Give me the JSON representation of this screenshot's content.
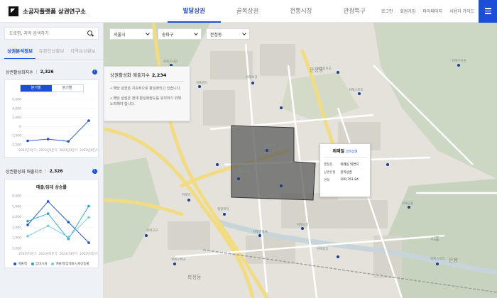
{
  "header": {
    "logo": "소공자플랫폼 상권연구소",
    "nav": [
      "발달상권",
      "골목상권",
      "전통시장",
      "관광특구"
    ],
    "util": [
      "로그인",
      "회원가입",
      "마이페이지",
      "사용자 가이드"
    ]
  },
  "sidebar": {
    "search_placeholder": "도로명, 지역 검색하기",
    "tabs": [
      "상권분석정보",
      "유관인상황보",
      "지역유상황보"
    ],
    "stat1": {
      "label": "상권활성화지수",
      "value": "2,326"
    },
    "stat2": {
      "label": "상권활성화 매출지수",
      "value": "2,326"
    },
    "toggle": [
      "분기별",
      "분기별"
    ],
    "chart2_title": "매출/임대 상승률",
    "legend2": [
      "매출액",
      "임대시세",
      "매출액/임대료시세상승률"
    ]
  },
  "map": {
    "selects": [
      "서울시",
      "송파구",
      "문정동"
    ],
    "tooltip": {
      "label": "상권활성화 매출지수",
      "value": "2,234",
      "line1": "• 해당 상권은 지속적으로 활성화되고 있습니다.",
      "line2": "• 해당 상권은 현재 활성화정도를 유지하기 위해 노력해야 합니다."
    },
    "popup": {
      "title": "위례일",
      "badge": "골목상권",
      "rows": [
        [
          "행정동",
          "위례동 외연지"
        ],
        [
          "상권유형",
          "골목상권"
        ],
        [
          "면적",
          "100,761.84"
        ]
      ]
    },
    "labels": [
      "문정동",
      "북정동",
      "시흥",
      "은행"
    ]
  },
  "colors": {
    "accent": "#1a4fd6",
    "selected_area": "#5c5c5c"
  },
  "chart_data": [
    {
      "type": "line",
      "categories": [
        "2023년1분기",
        "2023년2분기",
        "2023년3분기",
        "2023년4분기"
      ],
      "series": [
        {
          "values": [
            -900,
            -600,
            -1000,
            2700
          ]
        }
      ],
      "yticks": [
        "6,000",
        "4,000",
        "2,000",
        "0",
        "-1,000",
        "-1,200"
      ]
    },
    {
      "type": "line",
      "title": "매출/임대 상승률",
      "categories": [
        "2023년1분기",
        "2023년2분기",
        "2023년3분기",
        "2023년4분기"
      ],
      "series": [
        {
          "name": "매출액",
          "values": [
            3.1,
            5.6,
            3.4,
            1.2
          ]
        },
        {
          "name": "임대시세",
          "values": [
            3.5,
            4.3,
            1.6,
            5.1
          ]
        },
        {
          "name": "매출액/임대료시세상승률",
          "values": [
            1.9,
            3.0,
            1.8,
            3.9
          ]
        }
      ],
      "yticks": [
        "6,000",
        "5,000",
        "4,000",
        "3,000",
        "2,000",
        "1,000"
      ],
      "colors": [
        "#1a4fd6",
        "#2aa7c7",
        "#7cc9d8"
      ]
    }
  ]
}
